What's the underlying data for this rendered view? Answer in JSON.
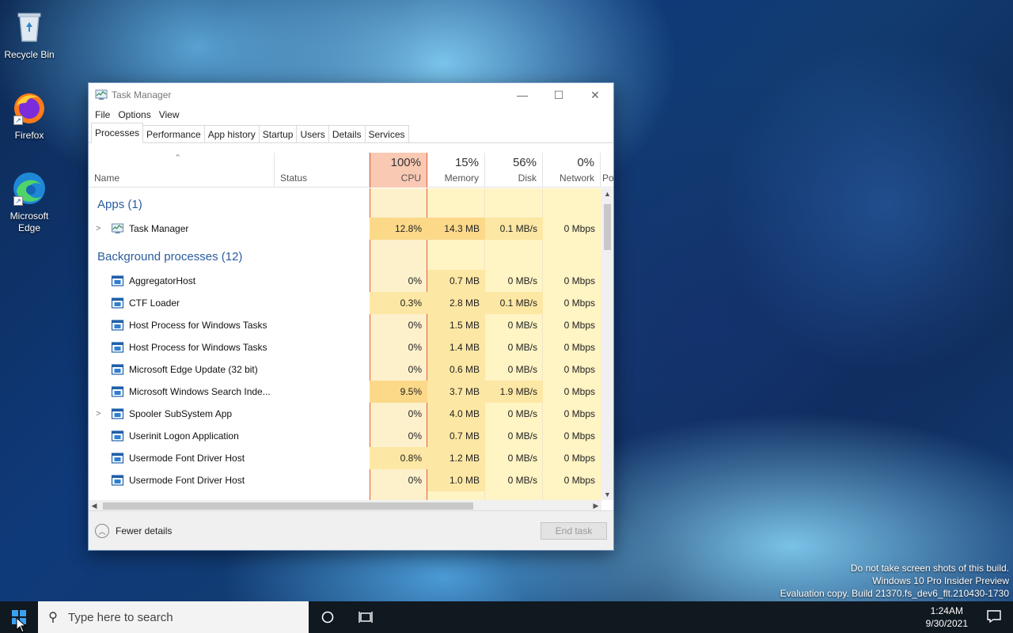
{
  "desktop": {
    "icons": [
      {
        "label": "Recycle Bin"
      },
      {
        "label": "Firefox"
      },
      {
        "label": "Microsoft Edge"
      }
    ],
    "watermark": [
      "Do not take screen shots of this build.",
      "Windows 10 Pro Insider Preview",
      "Evaluation copy. Build 21370.fs_dev6_flt.210430-1730"
    ]
  },
  "window": {
    "title": "Task Manager",
    "menu": [
      "File",
      "Options",
      "View"
    ],
    "tabs": [
      "Processes",
      "Performance",
      "App history",
      "Startup",
      "Users",
      "Details",
      "Services"
    ],
    "active_tab": "Processes"
  },
  "columns": {
    "name": "Name",
    "status": "Status",
    "cpu": {
      "pct": "100%",
      "label": "CPU"
    },
    "memory": {
      "pct": "15%",
      "label": "Memory"
    },
    "disk": {
      "pct": "56%",
      "label": "Disk"
    },
    "network": {
      "pct": "0%",
      "label": "Network"
    },
    "power_partial": "Po"
  },
  "groups": {
    "apps": "Apps (1)",
    "background": "Background processes (12)"
  },
  "apps": [
    {
      "name": "Task Manager",
      "cpu": "12.8%",
      "memory": "14.3 MB",
      "disk": "0.1 MB/s",
      "network": "0 Mbps"
    }
  ],
  "processes": [
    {
      "name": "AggregatorHost",
      "cpu": "0%",
      "memory": "0.7 MB",
      "disk": "0 MB/s",
      "network": "0 Mbps"
    },
    {
      "name": "CTF Loader",
      "cpu": "0.3%",
      "memory": "2.8 MB",
      "disk": "0.1 MB/s",
      "network": "0 Mbps"
    },
    {
      "name": "Host Process for Windows Tasks",
      "cpu": "0%",
      "memory": "1.5 MB",
      "disk": "0 MB/s",
      "network": "0 Mbps"
    },
    {
      "name": "Host Process for Windows Tasks",
      "cpu": "0%",
      "memory": "1.4 MB",
      "disk": "0 MB/s",
      "network": "0 Mbps"
    },
    {
      "name": "Microsoft Edge Update (32 bit)",
      "cpu": "0%",
      "memory": "0.6 MB",
      "disk": "0 MB/s",
      "network": "0 Mbps"
    },
    {
      "name": "Microsoft Windows Search Inde...",
      "cpu": "9.5%",
      "memory": "3.7 MB",
      "disk": "1.9 MB/s",
      "network": "0 Mbps"
    },
    {
      "name": "Spooler SubSystem App",
      "cpu": "0%",
      "memory": "4.0 MB",
      "disk": "0 MB/s",
      "network": "0 Mbps"
    },
    {
      "name": "Userinit Logon Application",
      "cpu": "0%",
      "memory": "0.7 MB",
      "disk": "0 MB/s",
      "network": "0 Mbps"
    },
    {
      "name": "Usermode Font Driver Host",
      "cpu": "0.8%",
      "memory": "1.2 MB",
      "disk": "0 MB/s",
      "network": "0 Mbps"
    },
    {
      "name": "Usermode Font Driver Host",
      "cpu": "0%",
      "memory": "1.0 MB",
      "disk": "0 MB/s",
      "network": "0 Mbps"
    }
  ],
  "footer": {
    "fewer_details": "Fewer details",
    "end_task": "End task"
  },
  "taskbar": {
    "search_placeholder": "Type here to search",
    "time": "1:24AM",
    "date": "9/30/2021"
  },
  "colors": {
    "cpu_header": "#f9c9b3",
    "cpu_border": "#e5593a",
    "heat_light": "#fff4c4",
    "heat_mid": "#fde7a4",
    "heat_high": "#fbd989",
    "group_title": "#2b5c9e"
  }
}
